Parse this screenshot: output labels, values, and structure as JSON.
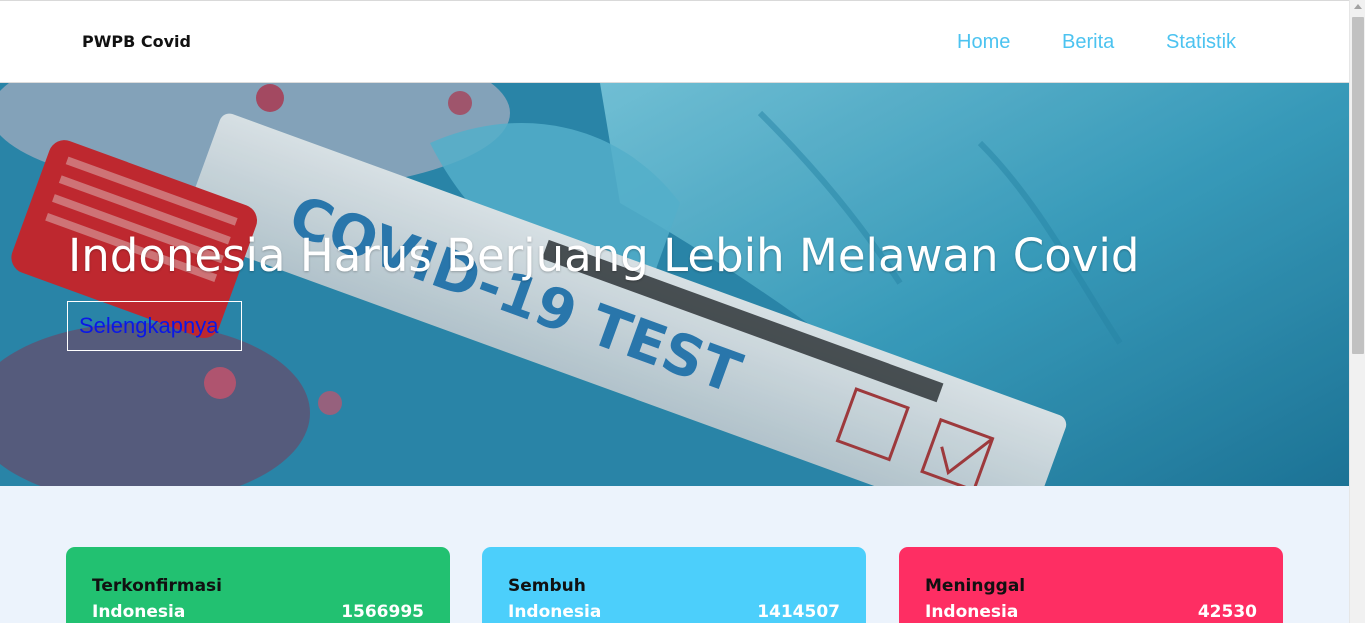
{
  "navbar": {
    "brand": "PWPB Covid",
    "links": [
      {
        "label": "Home"
      },
      {
        "label": "Berita"
      },
      {
        "label": "Statistik"
      }
    ]
  },
  "hero": {
    "title": "Indonesia Harus Berjuang Lebih Melawan Covid",
    "button_label": "Selengkapnya",
    "image_text": "COVID-19 TEST"
  },
  "stats": [
    {
      "title": "Terkonfirmasi",
      "country": "Indonesia",
      "value": "1566995",
      "color": "#22c171"
    },
    {
      "title": "Sembuh",
      "country": "Indonesia",
      "value": "1414507",
      "color": "#4ccffb"
    },
    {
      "title": "Meninggal",
      "country": "Indonesia",
      "value": "42530",
      "color": "#fe2e63"
    }
  ]
}
